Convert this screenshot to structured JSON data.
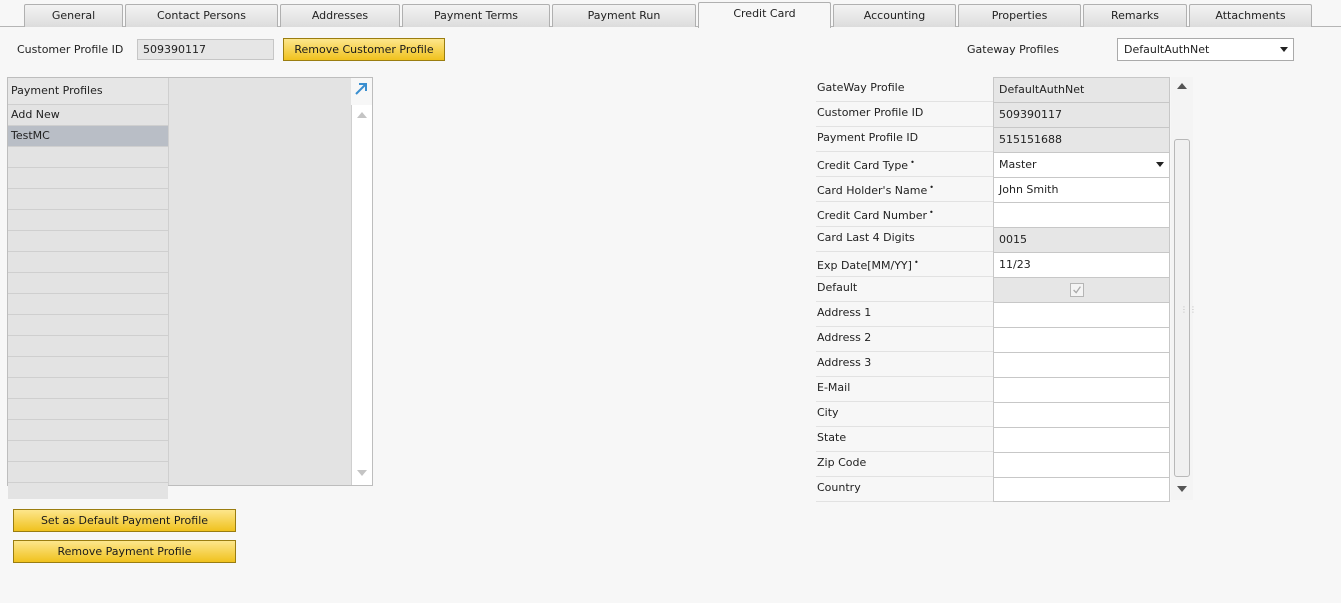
{
  "tabs": [
    {
      "label": "General"
    },
    {
      "label": "Contact Persons"
    },
    {
      "label": "Addresses"
    },
    {
      "label": "Payment Terms"
    },
    {
      "label": "Payment Run"
    },
    {
      "label": "Credit Card"
    },
    {
      "label": "Accounting"
    },
    {
      "label": "Properties"
    },
    {
      "label": "Remarks"
    },
    {
      "label": "Attachments"
    }
  ],
  "active_tab": "Credit Card",
  "header": {
    "customer_profile_label": "Customer Profile ID",
    "customer_profile_value": "509390117",
    "remove_customer_profile_label": "Remove Customer Profile",
    "gateway_profiles_label": "Gateway Profiles",
    "gateway_profiles_value": "DefaultAuthNet"
  },
  "payment_profiles": {
    "header": "Payment Profiles",
    "items": [
      "Add New",
      "TestMC"
    ],
    "selected": "TestMC"
  },
  "buttons": {
    "set_default_label": "Set as Default Payment Profile",
    "remove_payment_label": "Remove Payment Profile"
  },
  "form": {
    "rows": [
      {
        "label": "GateWay Profile",
        "value": "DefaultAuthNet",
        "readonly": true
      },
      {
        "label": "Customer Profile ID",
        "value": "509390117",
        "readonly": true
      },
      {
        "label": "Payment Profile ID",
        "value": "515151688",
        "readonly": true
      },
      {
        "label": "Credit Card Type",
        "value": "Master",
        "required": true
      },
      {
        "label": "Card Holder's Name",
        "value": "John Smith",
        "required": true
      },
      {
        "label": "Credit Card Number",
        "value": "",
        "required": true
      },
      {
        "label": "Card Last 4 Digits",
        "value": "0015",
        "readonly": true
      },
      {
        "label": "Exp Date[MM/YY]",
        "value": "11/23",
        "required": true
      },
      {
        "label": "Default",
        "checked": true,
        "readonly": true
      },
      {
        "label": "Address 1",
        "value": ""
      },
      {
        "label": "Address 2",
        "value": ""
      },
      {
        "label": "Address 3",
        "value": ""
      },
      {
        "label": "E-Mail",
        "value": ""
      },
      {
        "label": "City",
        "value": ""
      },
      {
        "label": "State",
        "value": ""
      },
      {
        "label": "Zip Code",
        "value": ""
      },
      {
        "label": "Country",
        "value": ""
      }
    ]
  },
  "required_marker": "•",
  "colors": {
    "accent_button": "#f0c21e",
    "selected_row": "#b9bec6",
    "readonly_field": "#e6e6e6"
  }
}
